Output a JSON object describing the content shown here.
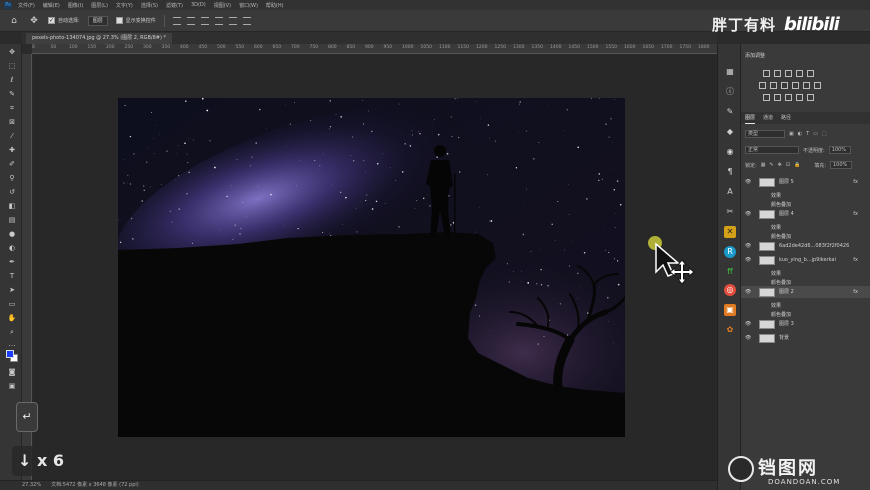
{
  "menubar": {
    "items": [
      "文件(F)",
      "编辑(E)",
      "图像(I)",
      "图层(L)",
      "文字(Y)",
      "选择(S)",
      "滤镜(T)",
      "3D(D)",
      "视图(V)",
      "窗口(W)",
      "帮助(H)"
    ]
  },
  "options": {
    "auto_select_label": "自动选择:",
    "auto_select_value": "图层",
    "show_transform_label": "显示变换控件"
  },
  "watermark_top": {
    "text": "胖丁有料",
    "logo": "bilibili"
  },
  "document": {
    "tab_title": "pexels-photo-134074.jpg @ 27.3% (图层 2, RGB/8#) *"
  },
  "ruler": {
    "ticks": [
      "0",
      "50",
      "100",
      "150",
      "200",
      "250",
      "300",
      "350",
      "400",
      "450",
      "500",
      "550",
      "600",
      "650",
      "700",
      "750",
      "800",
      "850",
      "900",
      "950",
      "1000",
      "1050",
      "1100",
      "1150",
      "1200",
      "1250",
      "1300",
      "1350",
      "1400",
      "1450",
      "1500",
      "1550",
      "1600",
      "1650",
      "1700",
      "1750",
      "1800"
    ]
  },
  "status": {
    "zoom": "27.32%",
    "doc": "文档:5472 像素 x 3648 像素 (72 ppi)"
  },
  "overlay": {
    "key": "↵",
    "count": "↓ x 6"
  },
  "panel": {
    "adjustments_title": "添加调整",
    "tabs": [
      "图层",
      "通道",
      "路径"
    ],
    "filter_label": "类型",
    "blend_mode": "正常",
    "opacity_label": "不透明度:",
    "opacity_value": "100%",
    "lock_label": "锁定:",
    "fill_label": "填充:",
    "fill_value": "100%",
    "layers": [
      {
        "name": "图层 5",
        "fx": "fx",
        "kind": "layer"
      },
      {
        "name": "效果",
        "kind": "sub"
      },
      {
        "name": "颜色叠加",
        "kind": "sub"
      },
      {
        "name": "图层 4",
        "fx": "fx",
        "kind": "layer"
      },
      {
        "name": "效果",
        "kind": "sub"
      },
      {
        "name": "颜色叠加",
        "kind": "sub"
      },
      {
        "name": "6ad2de42d6...083f2f2f0426",
        "kind": "layer"
      },
      {
        "name": "kuo_ying_b...jp9ikerkai",
        "fx": "fx",
        "kind": "layer"
      },
      {
        "name": "效果",
        "kind": "sub"
      },
      {
        "name": "颜色叠加",
        "kind": "sub"
      },
      {
        "name": "图层 2",
        "fx": "fx",
        "kind": "layer",
        "selected": true
      },
      {
        "name": "效果",
        "kind": "sub"
      },
      {
        "name": "颜色叠加",
        "kind": "sub"
      },
      {
        "name": "图层 3",
        "kind": "layer"
      },
      {
        "name": "背景",
        "kind": "layer"
      }
    ]
  },
  "watermark_bottom": {
    "name": "铛图网",
    "domain": "DOANDOAN.COM"
  },
  "colors": {
    "foreground": "#1a3cff",
    "background": "#ffffff",
    "accent": "#31a8ff"
  }
}
